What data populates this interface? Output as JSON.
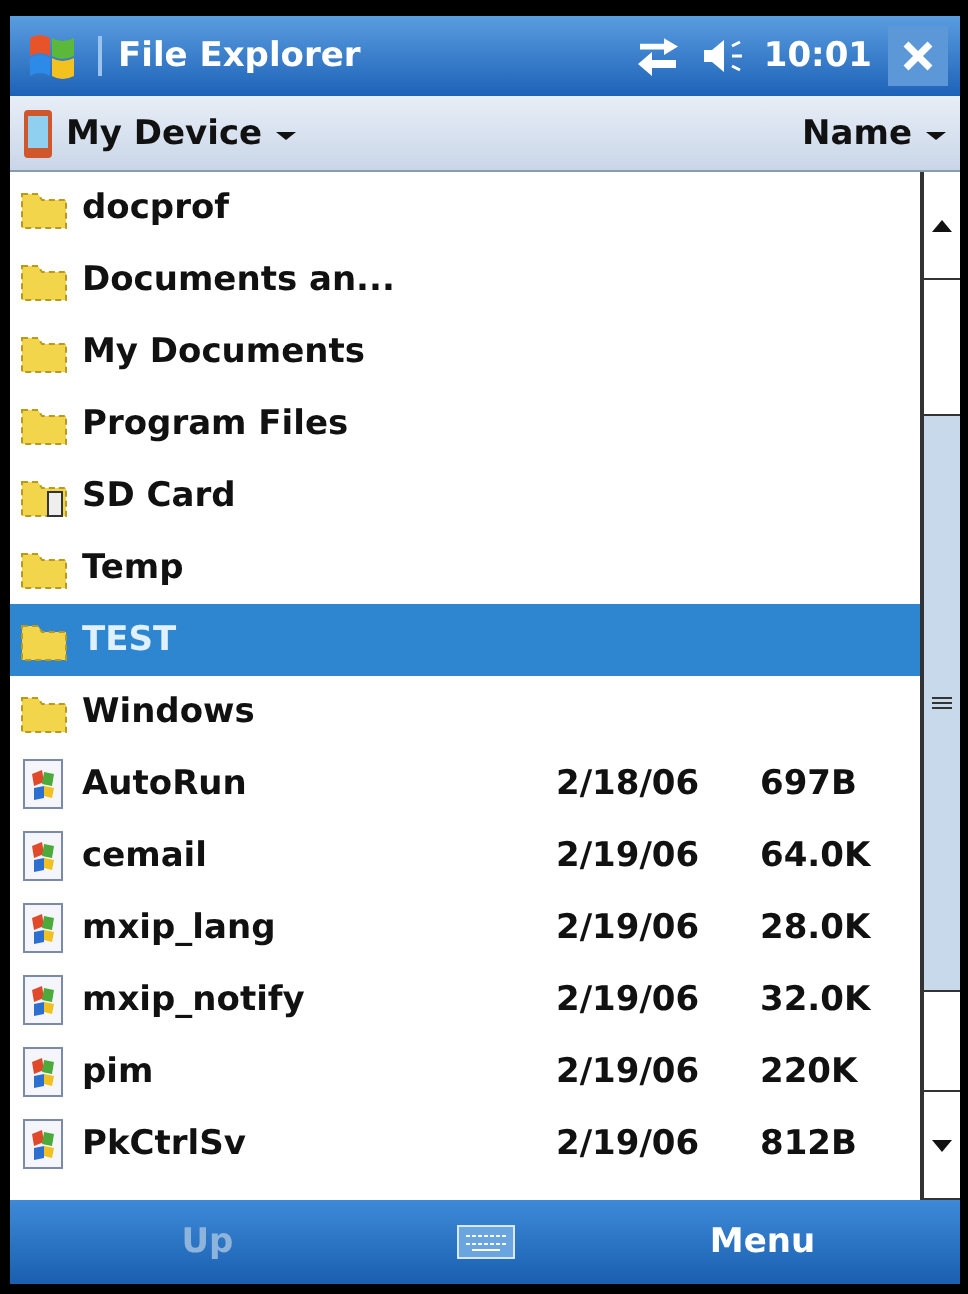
{
  "title_bar": {
    "title": "File Explorer",
    "time": "10:01"
  },
  "toolbar": {
    "location": "My Device",
    "sort": "Name"
  },
  "files": [
    {
      "kind": "folder",
      "name": "docprof",
      "selected": false
    },
    {
      "kind": "folder",
      "name": "Documents an...",
      "selected": false
    },
    {
      "kind": "folder",
      "name": "My Documents",
      "selected": false
    },
    {
      "kind": "folder",
      "name": "Program Files",
      "selected": false
    },
    {
      "kind": "card",
      "name": "SD Card",
      "selected": false
    },
    {
      "kind": "folder",
      "name": "Temp",
      "selected": false
    },
    {
      "kind": "folder",
      "name": "TEST",
      "selected": true
    },
    {
      "kind": "folder",
      "name": "Windows",
      "selected": false
    },
    {
      "kind": "file",
      "name": "AutoRun",
      "date": "2/18/06",
      "size": "697B",
      "selected": false
    },
    {
      "kind": "file",
      "name": "cemail",
      "date": "2/19/06",
      "size": "64.0K",
      "selected": false
    },
    {
      "kind": "file",
      "name": "mxip_lang",
      "date": "2/19/06",
      "size": "28.0K",
      "selected": false
    },
    {
      "kind": "file",
      "name": "mxip_notify",
      "date": "2/19/06",
      "size": "32.0K",
      "selected": false
    },
    {
      "kind": "file",
      "name": "pim",
      "date": "2/19/06",
      "size": "220K",
      "selected": false
    },
    {
      "kind": "file",
      "name": "PkCtrlSv",
      "date": "2/19/06",
      "size": "812B",
      "selected": false
    }
  ],
  "menu_bar": {
    "left": {
      "label": "Up",
      "disabled": true
    },
    "right": {
      "label": "Menu",
      "disabled": false
    }
  }
}
